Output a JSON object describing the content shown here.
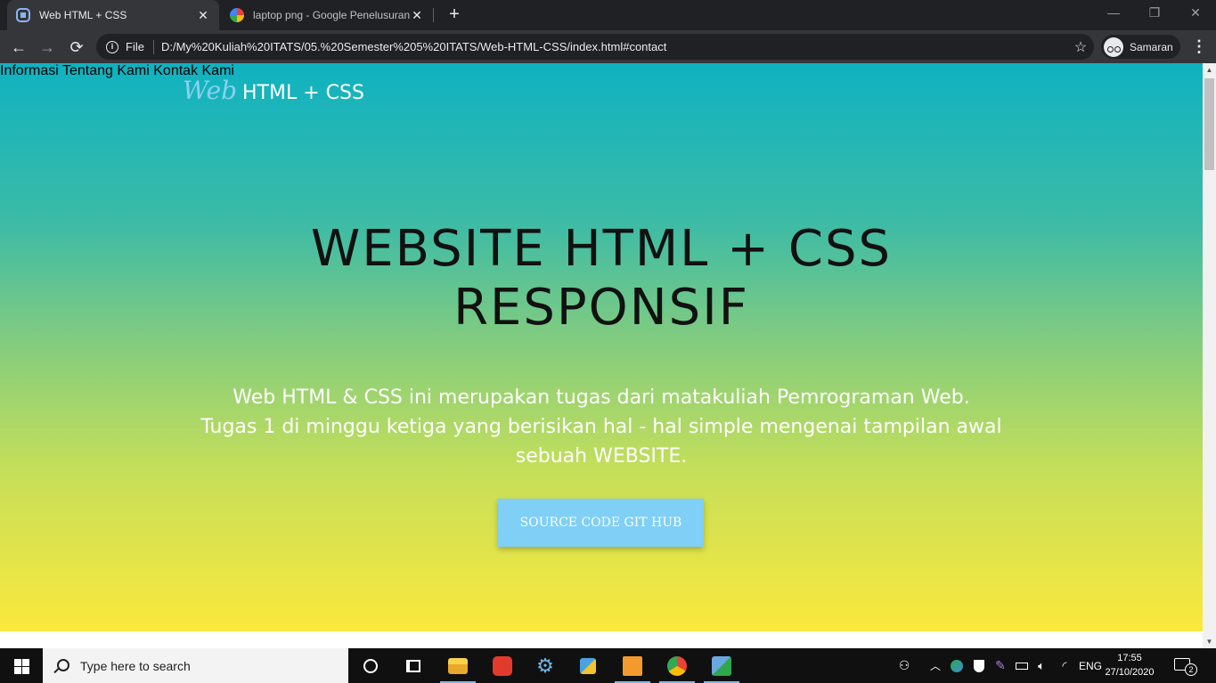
{
  "browser": {
    "tabs": [
      {
        "title": "Web HTML + CSS",
        "active": true,
        "favicon": "page-icon"
      },
      {
        "title": "laptop png - Google Penelusuran",
        "active": false,
        "favicon": "google-icon"
      }
    ],
    "new_tab_glyph": "+",
    "window_controls": {
      "minimize": "—",
      "restore": "❐",
      "close": "✕"
    },
    "toolbar": {
      "back": "←",
      "forward": "→",
      "reload": "⟳",
      "scheme_label": "File",
      "url": "D:/My%20Kuliah%20ITATS/05.%20Semester%205%20ITATS/Web-HTML-CSS/index.html#contact",
      "bookmark_glyph": "☆",
      "profile_label": "Samaran",
      "menu_glyph": "⋮"
    }
  },
  "site": {
    "brand": {
      "italic": "Web",
      "rest": "HTML + CSS"
    },
    "nav": [
      "Informasi",
      "Tentang Kami",
      "Kontak Kami"
    ],
    "hero": {
      "title_line1": "WEBSITE HTML + CSS",
      "title_line2": "RESPONSIF",
      "desc_line1": "Web HTML & CSS ini merupakan tugas dari matakuliah Pemrograman Web.",
      "desc_line2": "Tugas 1 di minggu ketiga yang berisikan hal - hal simple mengenai tampilan awal",
      "desc_line3": "sebuah WEBSITE.",
      "button": "SOURCE CODE GIT HUB"
    },
    "colors": {
      "gradient_top": "#0fb2c1",
      "gradient_bottom": "#fbe83c",
      "button_bg": "#7fcff7",
      "brand_italic": "#8bd0f0"
    }
  },
  "taskbar": {
    "search_placeholder": "Type here to search",
    "apps": [
      "cortana-icon",
      "task-view-icon",
      "file-explorer-icon",
      "app-red-icon",
      "settings-gear-icon",
      "network-app-icon",
      "sublime-text-icon",
      "chrome-icon",
      "game-app-icon"
    ],
    "tray": {
      "language": "ENG",
      "time": "17:55",
      "date": "27/10/2020",
      "notification_count": "2"
    }
  }
}
